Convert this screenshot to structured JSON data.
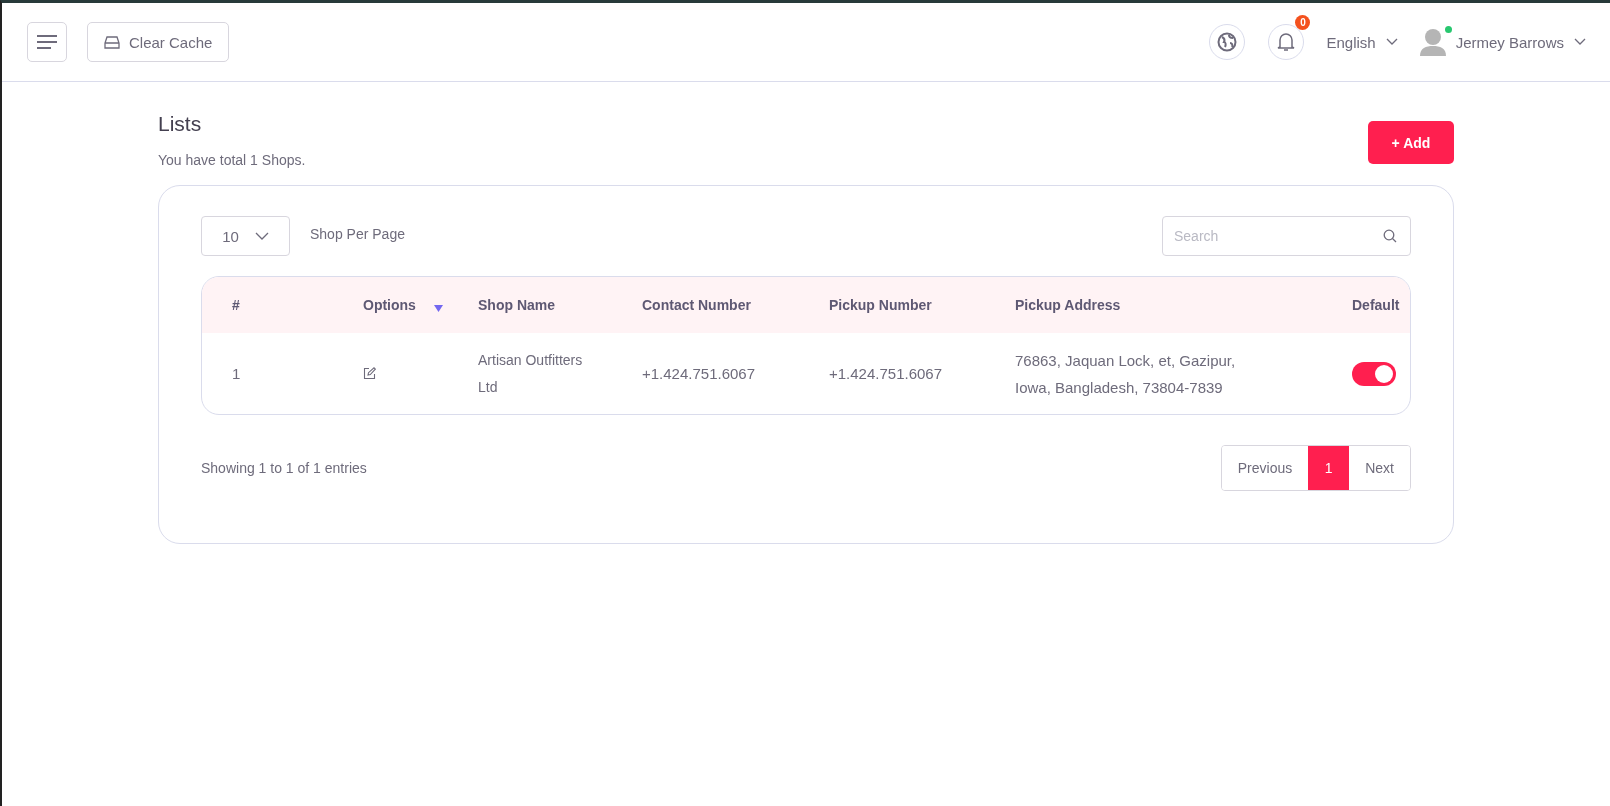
{
  "header": {
    "clear_cache": "Clear Cache",
    "notification_count": "0",
    "language": "English",
    "user": {
      "name": "Jermey Barrows",
      "online": true
    }
  },
  "page": {
    "title": "Lists",
    "subtitle": "You have total 1 Shops.",
    "add_button": "+ Add"
  },
  "controls": {
    "per_page": "10",
    "per_page_label": "Shop Per Page",
    "search": {
      "placeholder": "Search"
    }
  },
  "table": {
    "columns": [
      {
        "label": "#",
        "sortable": false
      },
      {
        "label": "Options",
        "sortable": true
      },
      {
        "label": "Shop Name",
        "sortable": false
      },
      {
        "label": "Contact Number",
        "sortable": false
      },
      {
        "label": "Pickup Number",
        "sortable": false
      },
      {
        "label": "Pickup Address",
        "sortable": false
      },
      {
        "label": "Default",
        "sortable": false
      }
    ],
    "rows": [
      {
        "index": "1",
        "shop_name": "Artisan Outfitters Ltd",
        "contact_number": "+1.424.751.6067",
        "pickup_number": "+1.424.751.6067",
        "pickup_address": "76863, Jaquan Lock, et, Gazipur, Iowa, Bangladesh, 73804-7839",
        "default": true
      }
    ]
  },
  "footer": {
    "info": "Showing 1 to 1 of 1 entries",
    "previous": "Previous",
    "pages": [
      {
        "label": "1",
        "selected": true
      }
    ],
    "next": "Next"
  }
}
